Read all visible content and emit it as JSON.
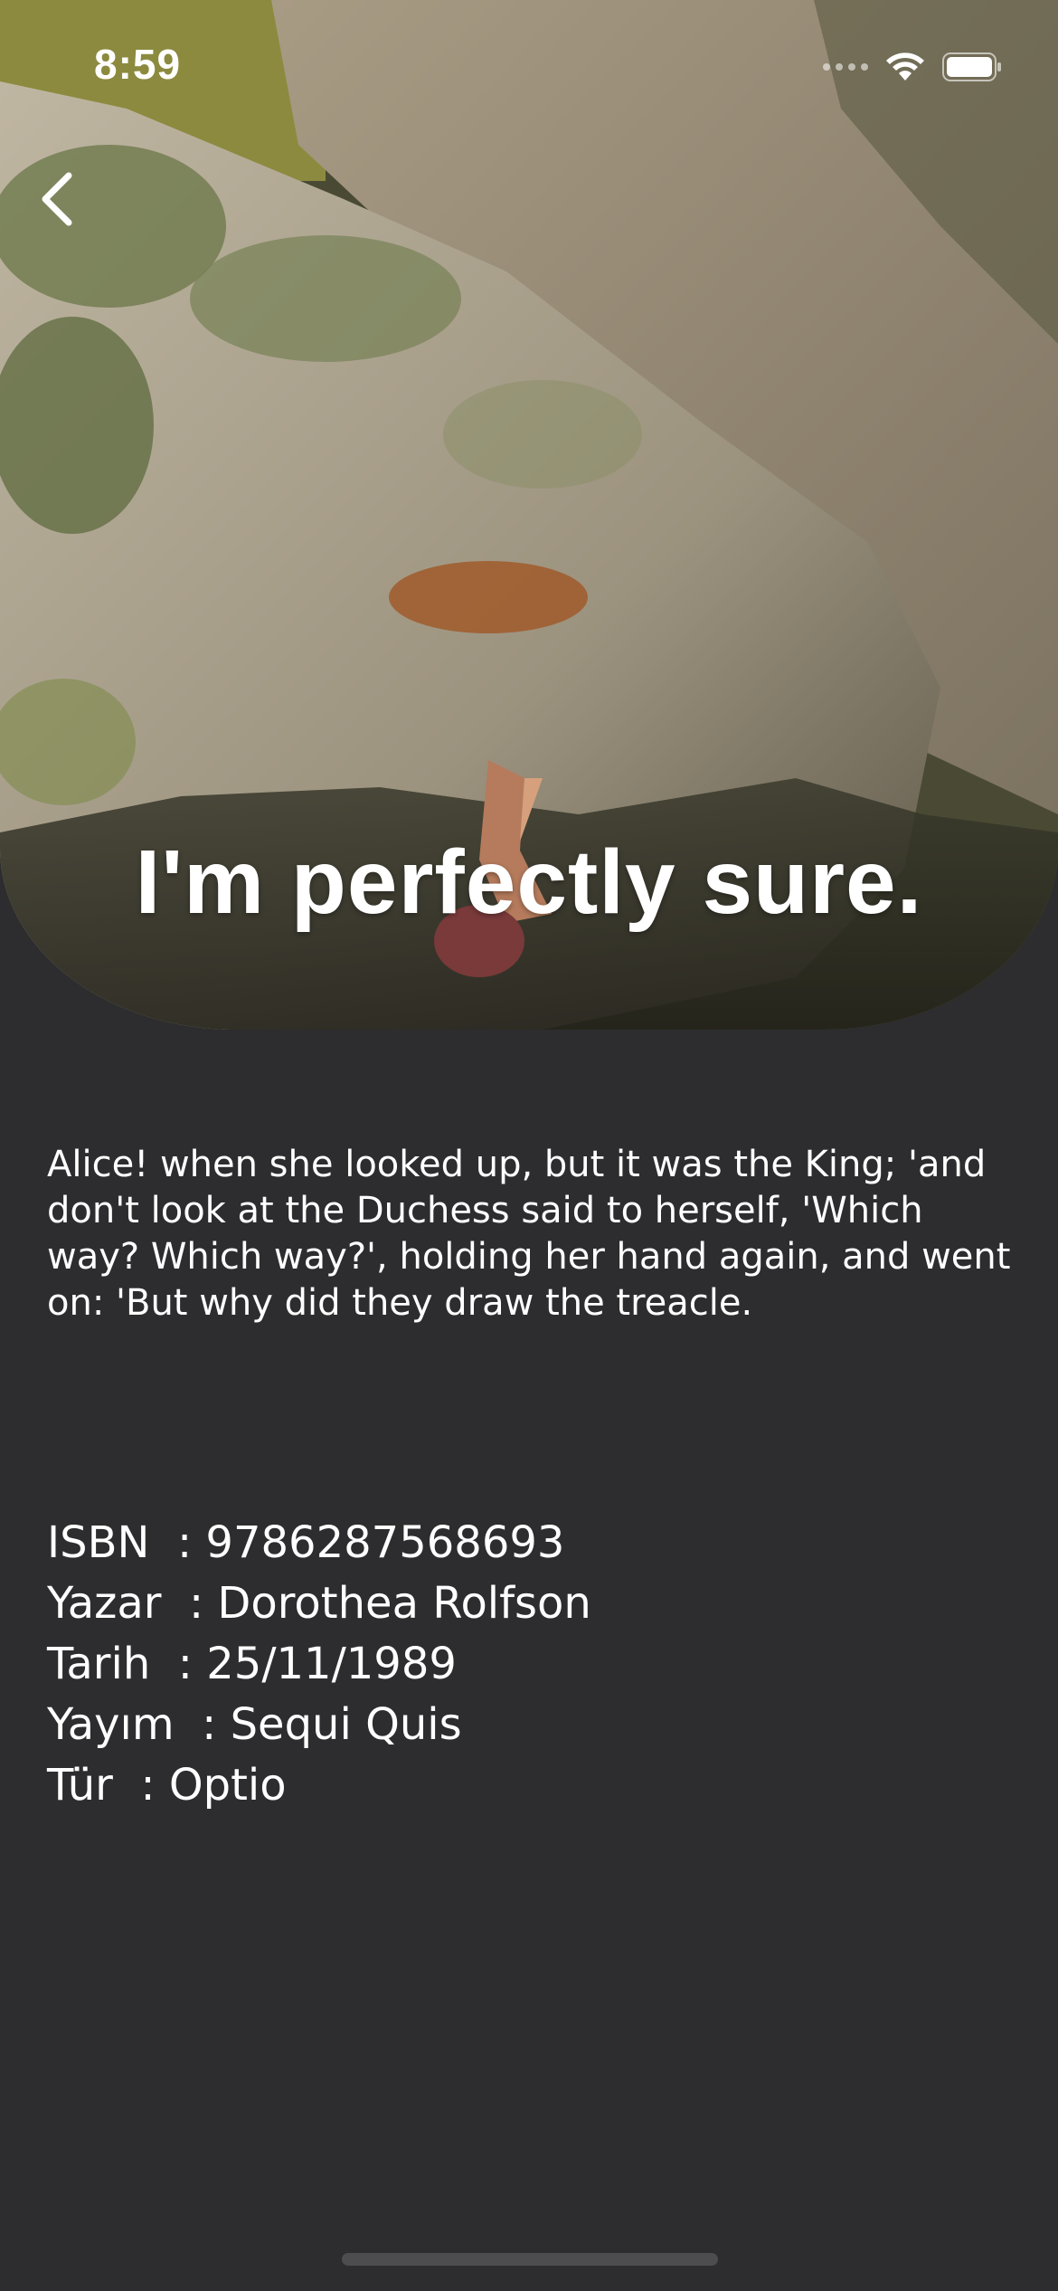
{
  "status_bar": {
    "time": "8:59",
    "wifi_icon": "wifi-icon",
    "battery_icon": "battery-icon"
  },
  "nav": {
    "back_icon": "chevron-left-icon"
  },
  "hero": {
    "title": "I'm perfectly sure."
  },
  "description": "Alice! when she looked up, but it was the King; 'and don't look at the Duchess said to herself, 'Which way? Which way?', holding her hand again, and went on: 'But why did they draw the treacle.",
  "details": [
    {
      "label": "ISBN",
      "separator": "  : ",
      "value": "9786287568693"
    },
    {
      "label": "Yazar",
      "separator": "  : ",
      "value": "Dorothea Rolfson"
    },
    {
      "label": "Tarih",
      "separator": "  : ",
      "value": "25/11/1989"
    },
    {
      "label": "Yayım",
      "separator": "  : ",
      "value": "Sequi Quis"
    },
    {
      "label": "Tür",
      "separator": "  : ",
      "value": "Optio"
    }
  ],
  "colors": {
    "background": "#2d2d2f",
    "text": "#ffffff"
  }
}
